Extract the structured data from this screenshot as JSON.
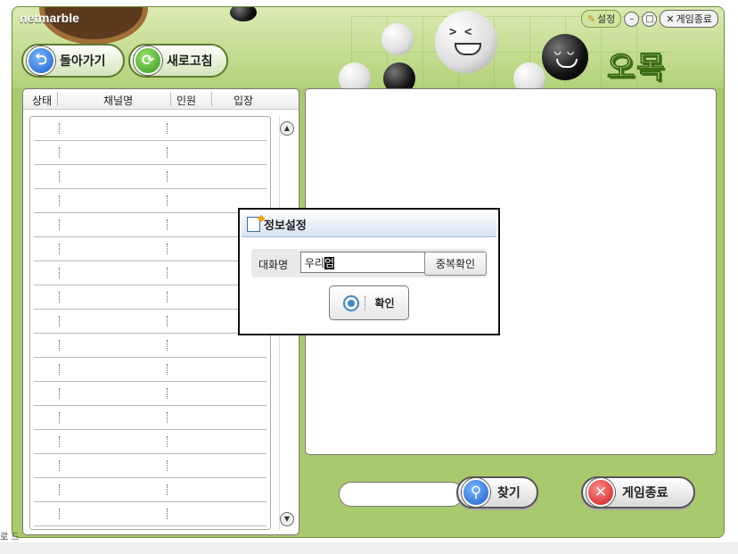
{
  "app": {
    "brand": "netmarble",
    "game_title": "오목"
  },
  "top_controls": {
    "settings_label": "설정",
    "minimize_symbol": "–",
    "maximize_symbol": "□",
    "exit_label": "게임종료",
    "exit_symbol": "✕"
  },
  "nav": {
    "back_label": "돌아가기",
    "refresh_label": "새로고침"
  },
  "channel_list": {
    "columns": [
      "상태",
      "채널명",
      "인원",
      "입장"
    ],
    "rows": [
      {
        "status": "",
        "name": "",
        "count": "",
        "enter": ""
      },
      {
        "status": "",
        "name": "",
        "count": "",
        "enter": ""
      },
      {
        "status": "",
        "name": "",
        "count": "",
        "enter": ""
      },
      {
        "status": "",
        "name": "",
        "count": "",
        "enter": ""
      },
      {
        "status": "",
        "name": "",
        "count": "",
        "enter": ""
      },
      {
        "status": "",
        "name": "",
        "count": "",
        "enter": ""
      },
      {
        "status": "",
        "name": "",
        "count": "",
        "enter": ""
      },
      {
        "status": "",
        "name": "",
        "count": "",
        "enter": ""
      },
      {
        "status": "",
        "name": "",
        "count": "",
        "enter": ""
      },
      {
        "status": "",
        "name": "",
        "count": "",
        "enter": ""
      },
      {
        "status": "",
        "name": "",
        "count": "",
        "enter": ""
      },
      {
        "status": "",
        "name": "",
        "count": "",
        "enter": ""
      },
      {
        "status": "",
        "name": "",
        "count": "",
        "enter": ""
      },
      {
        "status": "",
        "name": "",
        "count": "",
        "enter": ""
      },
      {
        "status": "",
        "name": "",
        "count": "",
        "enter": ""
      },
      {
        "status": "",
        "name": "",
        "count": "",
        "enter": ""
      },
      {
        "status": "",
        "name": "",
        "count": "",
        "enter": ""
      }
    ],
    "scroll_up": "▲",
    "scroll_down": "▼"
  },
  "search": {
    "value": "",
    "find_label": "찾기"
  },
  "exit_button_label": "게임종료",
  "dialog": {
    "title": "정보설정",
    "nickname_label": "대화명",
    "nickname_value": "우리",
    "nickname_composing": "엄",
    "check_duplicate_label": "중복확인",
    "ok_label": "확인"
  },
  "corner_text": "로 드",
  "icons": {
    "back": "back-arrow-icon",
    "refresh": "refresh-icon",
    "find": "magnifier-icon",
    "exit": "x-circle-icon",
    "settings": "wrench-icon",
    "dialog": "document-icon",
    "ok": "radio-icon"
  },
  "colors": {
    "frame_green": "#a9c96d",
    "header_light": "#dbeab2",
    "title_outline": "#3b6d12",
    "blue_icon": "#1a5fc9",
    "red_icon": "#d21b1b",
    "green_icon": "#2f9a1d"
  }
}
